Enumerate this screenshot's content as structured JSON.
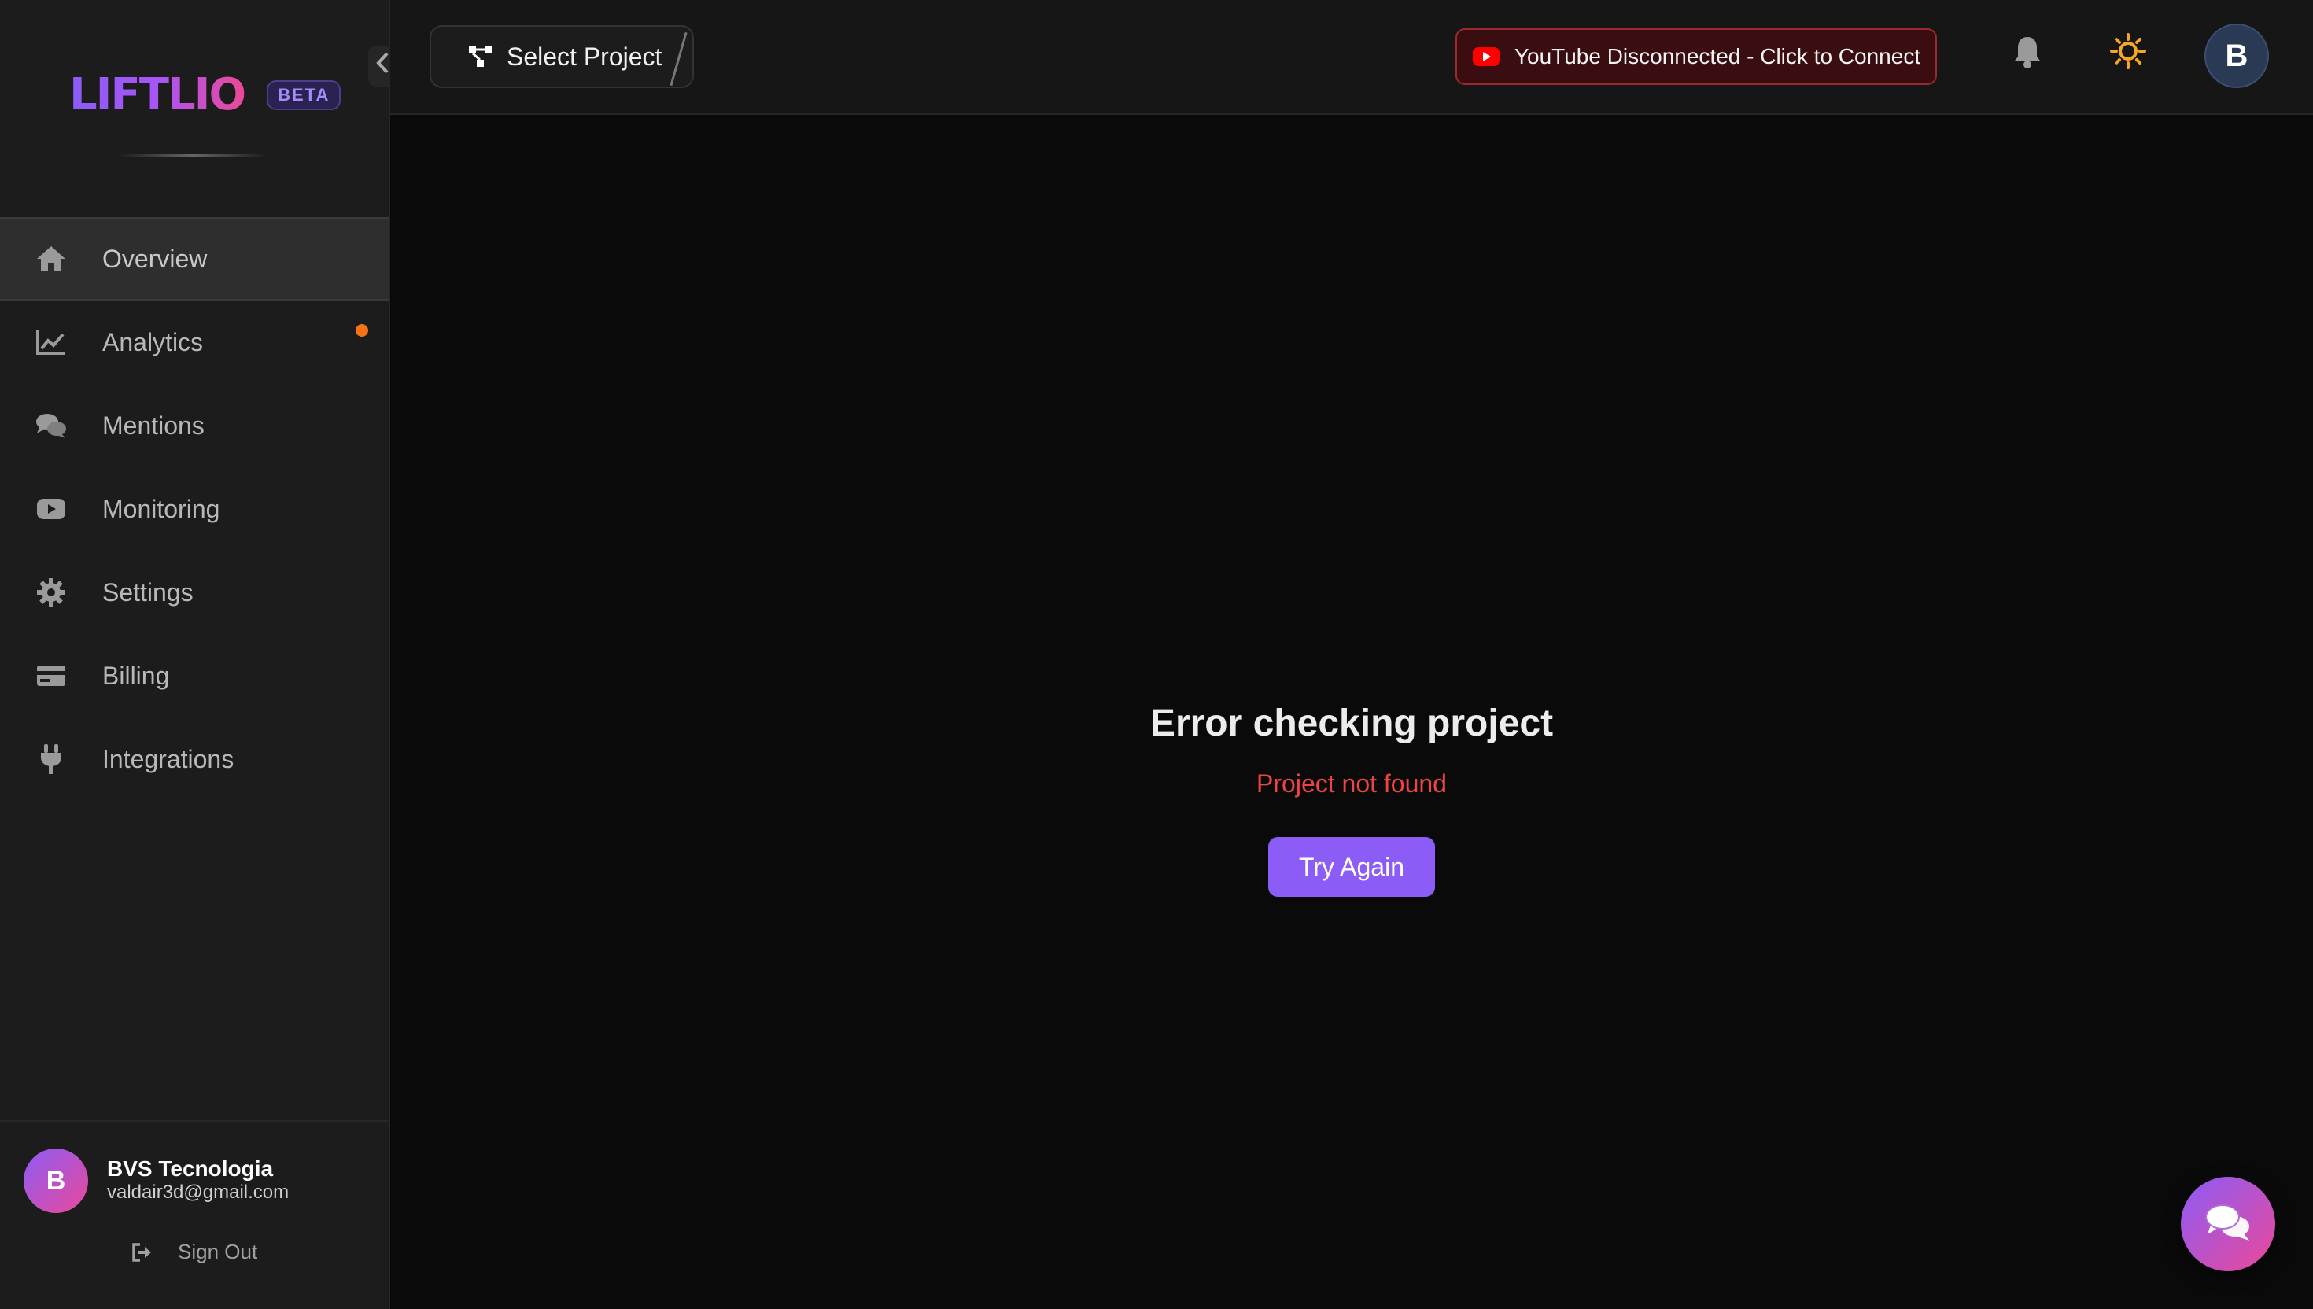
{
  "sidebar": {
    "logo": "LIFTLIO",
    "beta_badge": "BETA",
    "items": [
      {
        "label": "Overview",
        "icon": "home-icon",
        "active": true
      },
      {
        "label": "Analytics",
        "icon": "chart-line-icon",
        "notification": true
      },
      {
        "label": "Mentions",
        "icon": "comments-icon"
      },
      {
        "label": "Monitoring",
        "icon": "youtube-icon"
      },
      {
        "label": "Settings",
        "icon": "gear-icon"
      },
      {
        "label": "Billing",
        "icon": "credit-card-icon"
      },
      {
        "label": "Integrations",
        "icon": "plug-icon"
      }
    ],
    "user": {
      "initial": "B",
      "name": "BVS Tecnologia",
      "email": "valdair3d@gmail.com"
    },
    "sign_out": "Sign Out"
  },
  "header": {
    "select_project": "Select Project",
    "youtube_status": "YouTube Disconnected - Click to Connect",
    "avatar_initial": "B"
  },
  "main": {
    "error_title": "Error checking project",
    "error_message": "Project not found",
    "retry_label": "Try Again"
  },
  "colors": {
    "accent": "#8b5cf6",
    "accent_pink": "#ec4899",
    "error": "#ef4444",
    "notification_dot": "#f97316",
    "youtube_red": "#ff0000",
    "theme_sun": "#f5a623"
  }
}
